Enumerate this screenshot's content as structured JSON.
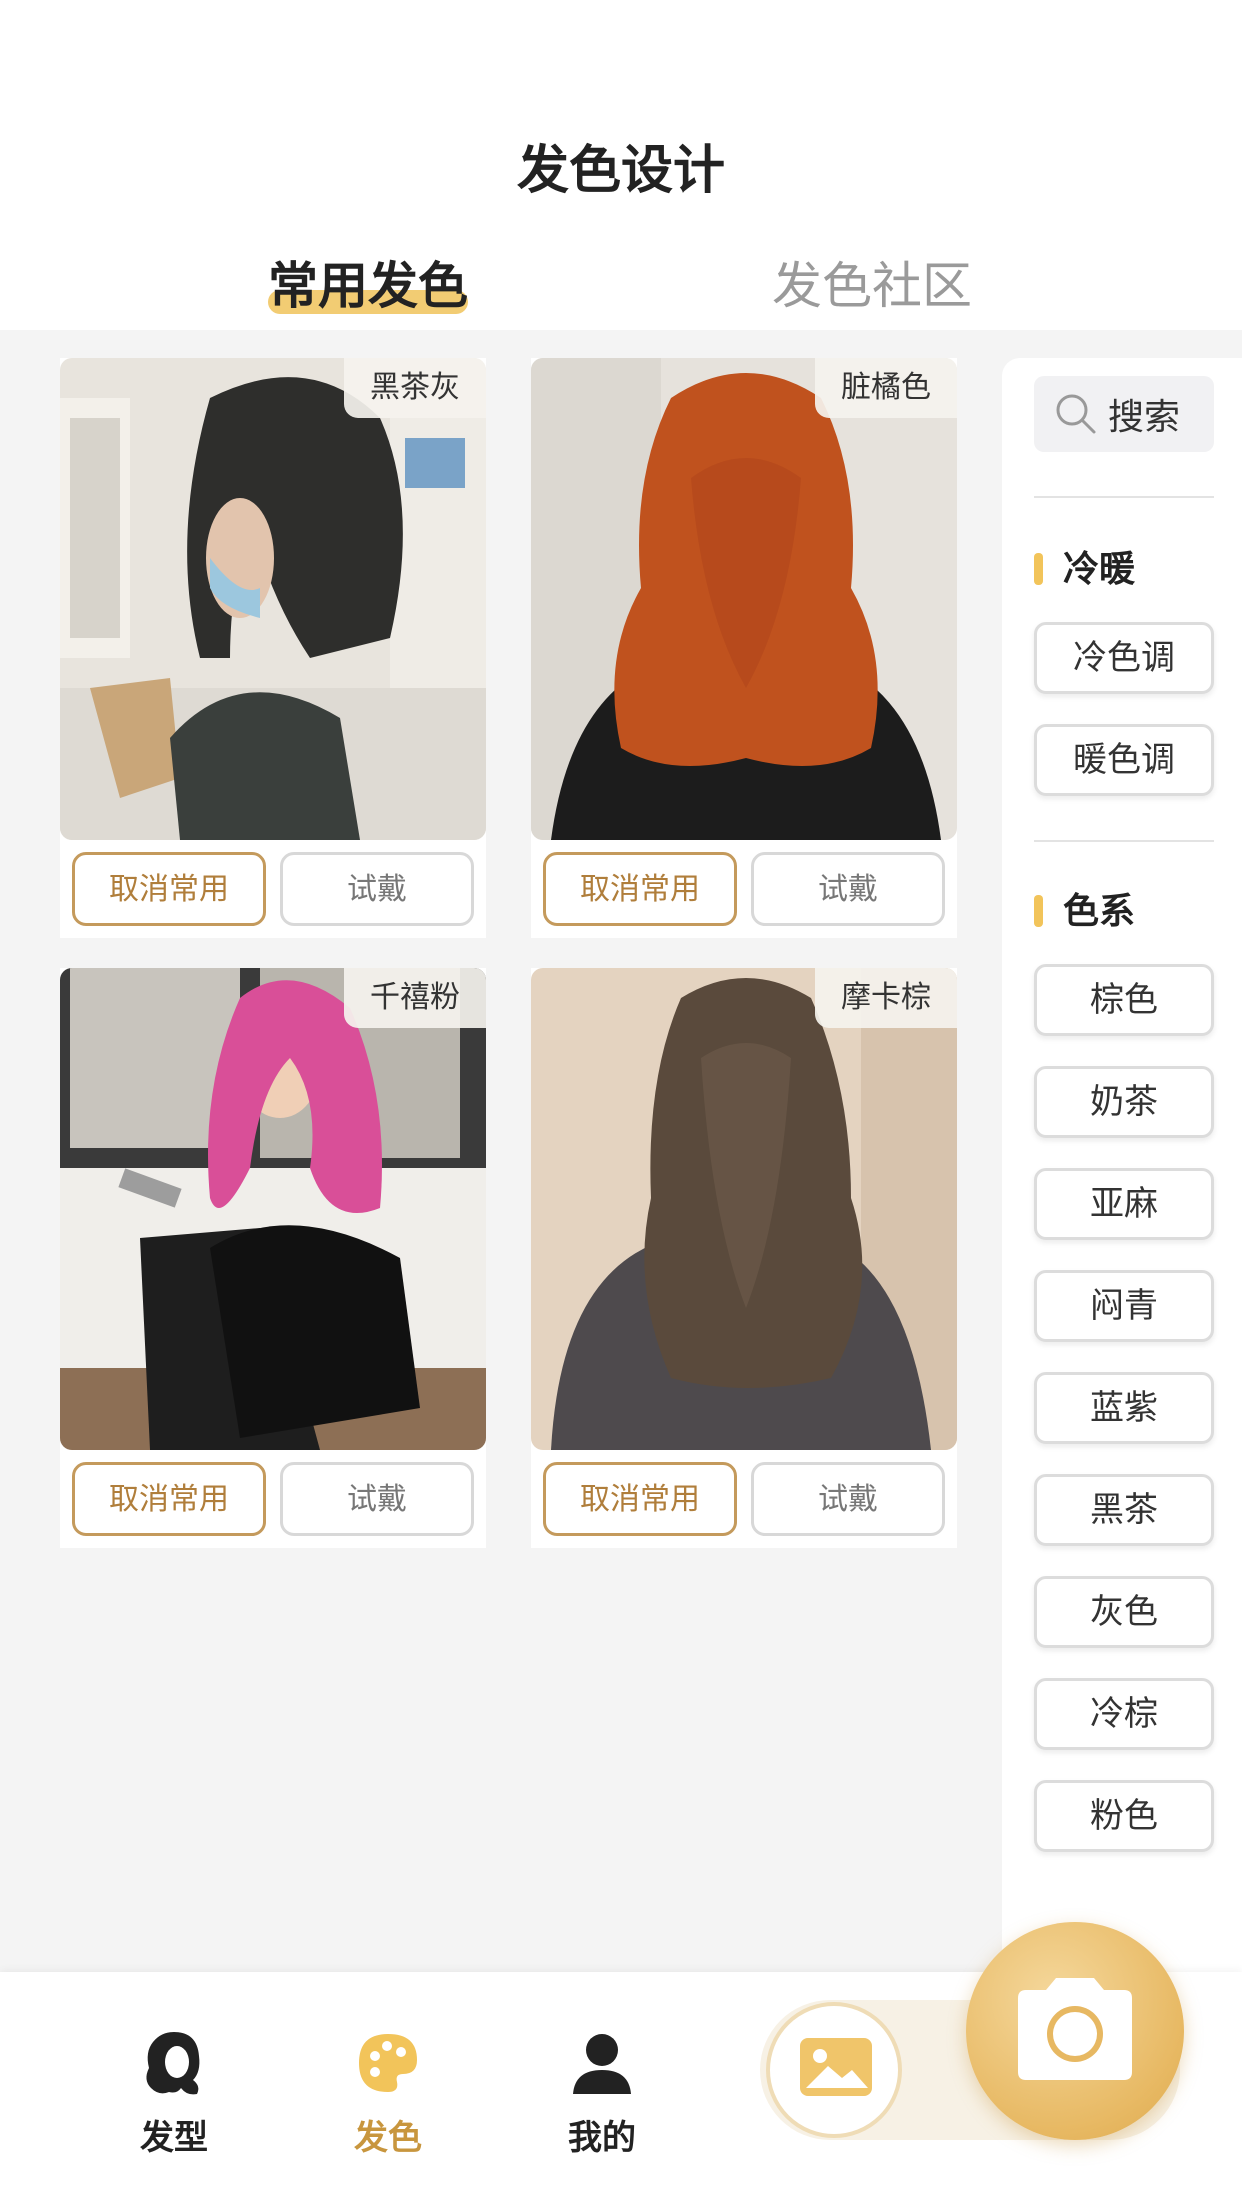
{
  "header": {
    "title": "发色设计",
    "tabs": [
      {
        "label": "常用发色",
        "active": true
      },
      {
        "label": "发色社区",
        "active": false
      }
    ]
  },
  "cards": [
    {
      "name": "黑茶灰",
      "cancel_label": "取消常用",
      "try_label": "试戴",
      "hair_color": "#2e2e2c"
    },
    {
      "name": "脏橘色",
      "cancel_label": "取消常用",
      "try_label": "试戴",
      "hair_color": "#c0521e"
    },
    {
      "name": "千禧粉",
      "cancel_label": "取消常用",
      "try_label": "试戴",
      "hair_color": "#d94f98"
    },
    {
      "name": "摩卡棕",
      "cancel_label": "取消常用",
      "try_label": "试戴",
      "hair_color": "#5a4a3c"
    }
  ],
  "sidebar": {
    "search_label": "搜索",
    "section_warmth": {
      "title": "冷暖",
      "items": [
        "冷色调",
        "暖色调"
      ]
    },
    "section_color": {
      "title": "色系",
      "items": [
        "棕色",
        "奶茶",
        "亚麻",
        "闷青",
        "蓝紫",
        "黑茶",
        "灰色",
        "冷棕",
        "粉色"
      ]
    }
  },
  "bottom_nav": {
    "items": [
      {
        "label": "发型",
        "icon": "hair-icon"
      },
      {
        "label": "发色",
        "icon": "palette-icon",
        "active": true
      },
      {
        "label": "我的",
        "icon": "user-icon"
      }
    ],
    "gallery_icon": "image-icon",
    "camera_icon": "camera-icon"
  },
  "colors": {
    "accent": "#c49a5c",
    "highlight": "#f2cc73",
    "active_nav": "#c8963e"
  }
}
